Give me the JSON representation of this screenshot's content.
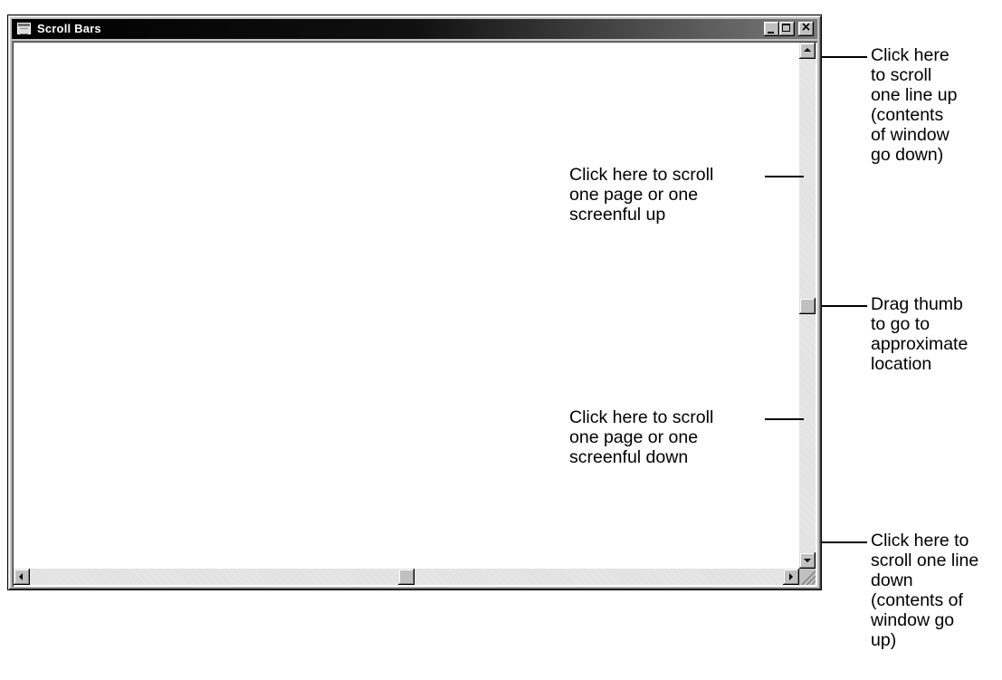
{
  "window": {
    "title": "Scroll Bars",
    "title_icon": "window-menu-icon",
    "controls": {
      "minimize_icon": "minimize-icon",
      "maximize_icon": "maximize-icon",
      "close_icon": "close-icon",
      "close_glyph": "×"
    }
  },
  "scrollbars": {
    "vertical": {
      "up_icon": "arrow-up-icon",
      "down_icon": "arrow-down-icon",
      "thumb_position": 0.5
    },
    "horizontal": {
      "left_icon": "arrow-left-icon",
      "right_icon": "arrow-right-icon",
      "thumb_position": 0.5
    }
  },
  "annotations": {
    "line_up": "Click here\nto scroll\none line up\n(contents\nof window\ngo down)",
    "page_up": "Click here to scroll\none page or one\nscreenful up",
    "thumb": "Drag thumb\nto go to\napproximate\nlocation",
    "page_down": "Click here to scroll\none page or one\nscreenful down",
    "line_down": "Click here to\nscroll one line\ndown\n(contents of\nwindow go\nup)"
  },
  "colors": {
    "face": "#c0c0c0",
    "titlebar_start": "#000000",
    "titlebar_end": "#7a7a7a",
    "client": "#ffffff"
  }
}
